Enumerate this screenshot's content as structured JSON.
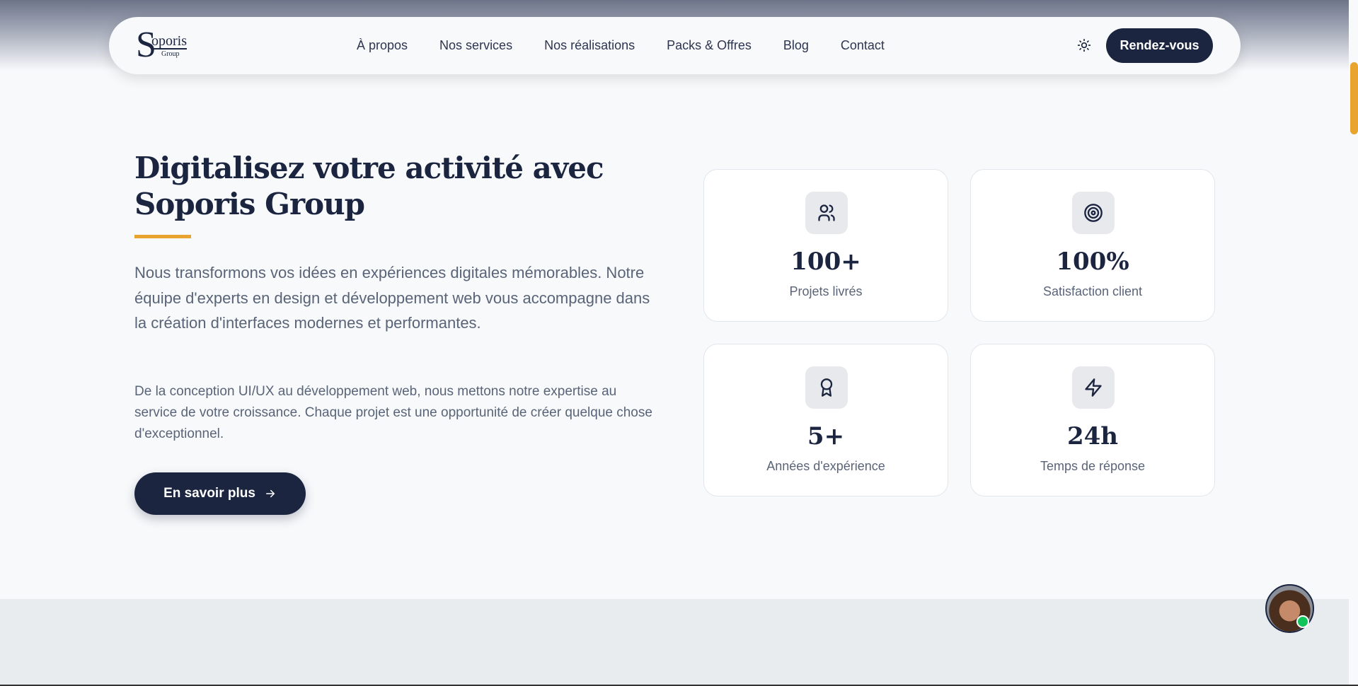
{
  "header": {
    "logo_text": "Soporis Group",
    "nav": [
      "À propos",
      "Nos services",
      "Nos réalisations",
      "Packs & Offres",
      "Blog",
      "Contact"
    ],
    "cta": "Rendez-vous"
  },
  "hero": {
    "title": "Digitalisez votre activité avec Soporis Group",
    "p1": "Nous transformons vos idées en expériences digitales mémorables. Notre équipe d'experts en design et développement web vous accompagne dans la création d'interfaces modernes et performantes.",
    "p2": "De la conception UI/UX au développement web, nous mettons notre expertise au service de votre croissance. Chaque projet est une opportunité de créer quelque chose d'exceptionnel.",
    "button": "En savoir plus"
  },
  "stats": [
    {
      "value": "100+",
      "label": "Projets livrés"
    },
    {
      "value": "100%",
      "label": "Satisfaction client"
    },
    {
      "value": "5+",
      "label": "Années d'expérience"
    },
    {
      "value": "24h",
      "label": "Temps de réponse"
    }
  ],
  "colors": {
    "primary": "#1b2540",
    "accent": "#e8a42e",
    "online": "#10c45a"
  }
}
